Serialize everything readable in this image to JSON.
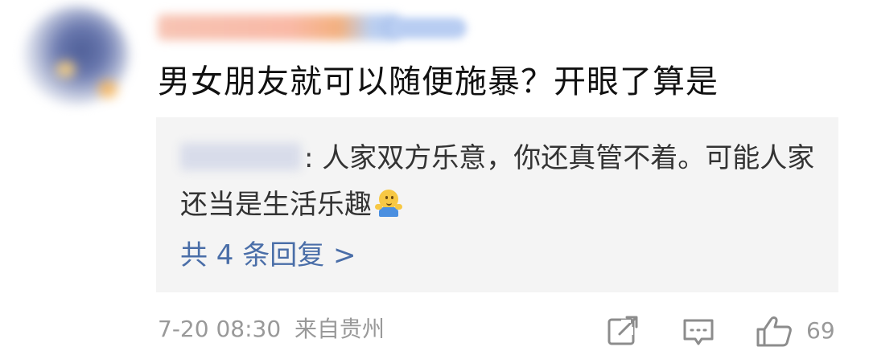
{
  "comment": {
    "text": "男女朋友就可以随便施暴？开眼了算是"
  },
  "reply": {
    "text_line": ": 人家双方乐意，你还真管不着。可能人家还当是生活乐趣",
    "emoji_icon": "shrug-emoji",
    "more_label": "共 4 条回复 >"
  },
  "meta": {
    "date": "7-20 08:30",
    "location": "来自贵州"
  },
  "actions": {
    "share_icon": "share-icon",
    "comment_icon": "comment-icon",
    "like_icon": "thumbs-up-icon",
    "like_count": "69"
  },
  "colors": {
    "link": "#4a6ea8",
    "meta": "#999999",
    "reply_bg": "#f4f4f4"
  }
}
